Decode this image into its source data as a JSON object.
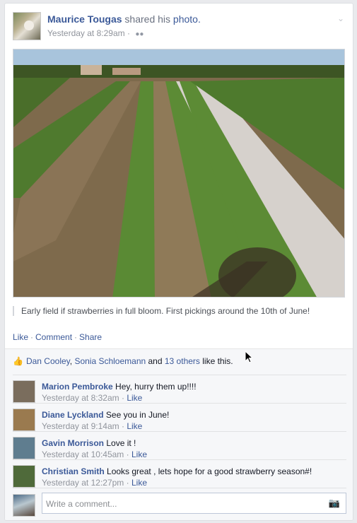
{
  "post": {
    "author": "Maurice Tougas",
    "action_verb": " shared his ",
    "action_object": "photo.",
    "timestamp": "Yesterday at 8:29am",
    "meta_sep": " · ",
    "audience_icon": "friends-icon",
    "caption": "Early field if strawberries in full bloom. First pickings around the 10th of June!"
  },
  "actions": {
    "like": "Like",
    "comment": "Comment",
    "share": "Share",
    "sep": "·"
  },
  "likes": {
    "name1": "Dan Cooley",
    "comma": ", ",
    "name2": "Sonia Schloemann",
    "and": " and ",
    "others": "13 others",
    "tail": " like this."
  },
  "comments": [
    {
      "name": "Marion Pembroke",
      "text": " Hey, hurry them up!!!!",
      "time": "Yesterday at 8:32am",
      "sep": " · ",
      "like": "Like",
      "avatar_color": "#7a6d5d"
    },
    {
      "name": "Diane Lyckland",
      "text": " See you in June!",
      "time": "Yesterday at 9:14am",
      "sep": " · ",
      "like": "Like",
      "avatar_color": "#9a7a4f"
    },
    {
      "name": "Gavin Morrison",
      "text": " Love it !",
      "time": "Yesterday at 10:45am",
      "sep": " · ",
      "like": "Like",
      "avatar_color": "#5f7d8f"
    },
    {
      "name": "Christian Smith",
      "text": " Looks great , lets hope for a good strawberry season#!",
      "time": "Yesterday at 12:27pm",
      "sep": " · ",
      "like": "Like",
      "avatar_color": "#4f6a3a"
    }
  ],
  "composer": {
    "placeholder": "Write a comment...",
    "camera_icon": "camera-icon"
  }
}
